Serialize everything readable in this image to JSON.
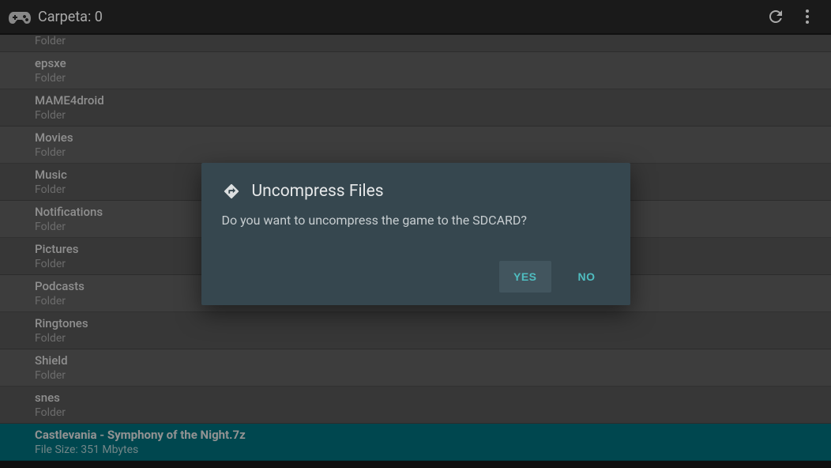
{
  "appBar": {
    "title": "Carpeta: 0"
  },
  "fileList": [
    {
      "name": "",
      "type": "Folder",
      "selected": false,
      "partial": true
    },
    {
      "name": "epsxe",
      "type": "Folder",
      "selected": false
    },
    {
      "name": "MAME4droid",
      "type": "Folder",
      "selected": false
    },
    {
      "name": "Movies",
      "type": "Folder",
      "selected": false
    },
    {
      "name": "Music",
      "type": "Folder",
      "selected": false
    },
    {
      "name": "Notifications",
      "type": "Folder",
      "selected": false
    },
    {
      "name": "Pictures",
      "type": "Folder",
      "selected": false
    },
    {
      "name": "Podcasts",
      "type": "Folder",
      "selected": false
    },
    {
      "name": "Ringtones",
      "type": "Folder",
      "selected": false
    },
    {
      "name": "Shield",
      "type": "Folder",
      "selected": false
    },
    {
      "name": "snes",
      "type": "Folder",
      "selected": false
    },
    {
      "name": "Castlevania - Symphony of the Night.7z",
      "type": "File Size: 351 Mbytes",
      "selected": true
    }
  ],
  "dialog": {
    "title": "Uncompress Files",
    "message": "Do you want to uncompress the game to the SDCARD?",
    "yesLabel": "YES",
    "noLabel": "NO"
  }
}
